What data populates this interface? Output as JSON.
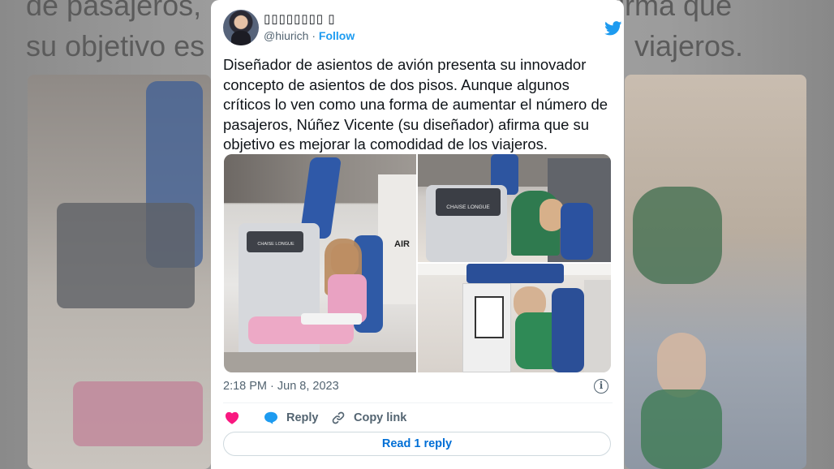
{
  "background": {
    "line1": "de pasajeros,",
    "line1_right": "afirma que",
    "line2": "su objetivo es",
    "line2_right": "viajeros."
  },
  "tweet": {
    "author_name": "▯▯▯▯▯▯▯▯ ▯",
    "handle": "@hiurich",
    "separator": " · ",
    "follow_label": "Follow",
    "text": "Diseñador de asientos de avión presenta su innovador concepto de asientos de dos pisos. Aunque algunos críticos lo ven como una forma de aumentar el número de pasajeros, Núñez Vicente (su diseñador) afirma que su objetivo es mejorar la comodidad de los viajeros.",
    "timestamp": "2:18 PM · Jun 8, 2023",
    "info_glyph": "i",
    "media": {
      "seat_brand": "CHAISE LONGUE",
      "booth_text": "AIR"
    }
  },
  "actions": {
    "reply_label": "Reply",
    "copy_link_label": "Copy link",
    "read_replies_label": "Read 1 reply"
  },
  "colors": {
    "accent": "#1d9bf0",
    "like": "#f91880",
    "link_button_text": "#006fd6",
    "text_primary": "#0f1419",
    "text_secondary": "#536471"
  },
  "icons": [
    "twitter-bird-icon",
    "heart-icon",
    "reply-bubble-icon",
    "link-icon",
    "info-icon"
  ]
}
